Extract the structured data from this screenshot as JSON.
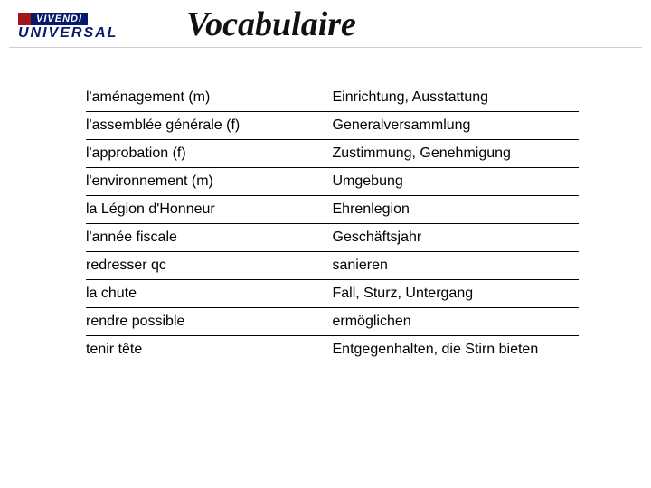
{
  "logo": {
    "line1": "VIVENDI",
    "line2": "UNIVERSAL"
  },
  "title": "Vocabulaire",
  "vocab": [
    {
      "fr": "l'aménagement (m)",
      "de": "Einrichtung, Ausstattung"
    },
    {
      "fr": "l'assemblée générale (f)",
      "de": "Generalversammlung"
    },
    {
      "fr": "l'approbation (f)",
      "de": "Zustimmung, Genehmigung"
    },
    {
      "fr": "l'environnement (m)",
      "de": "Umgebung"
    },
    {
      "fr": "la Légion d'Honneur",
      "de": "Ehrenlegion"
    },
    {
      "fr": "l'année fiscale",
      "de": "Geschäftsjahr"
    },
    {
      "fr": "redresser qc",
      "de": "sanieren"
    },
    {
      "fr": "la chute",
      "de": "Fall, Sturz, Untergang"
    },
    {
      "fr": "rendre possible",
      "de": "ermöglichen"
    },
    {
      "fr": "tenir tête",
      "de": "Entgegenhalten, die Stirn bieten"
    }
  ]
}
